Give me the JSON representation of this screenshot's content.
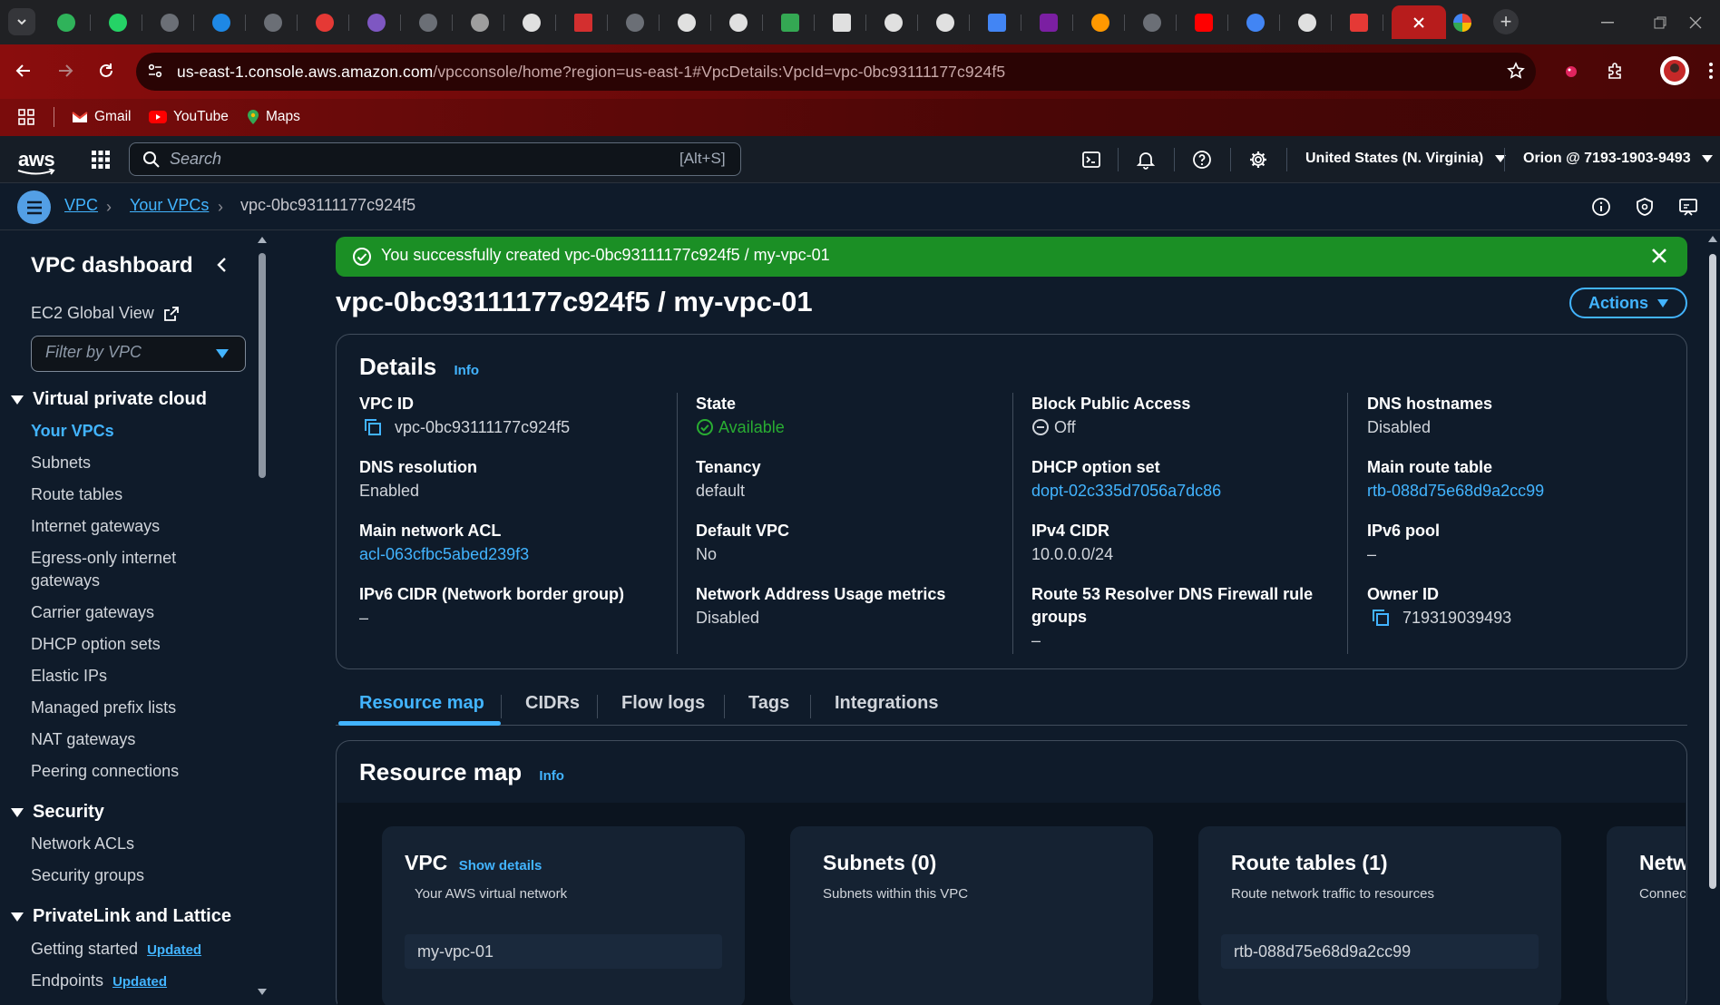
{
  "browser": {
    "url_domain": "us-east-1.console.aws.amazon.com",
    "url_path": "/vpcconsole/home?region=us-east-1#VpcDetails:VpcId=vpc-0bc93111177c924f5",
    "bookmarks": [
      {
        "label": "Gmail",
        "icon": "gmail-icon"
      },
      {
        "label": "YouTube",
        "icon": "youtube-icon"
      },
      {
        "label": "Maps",
        "icon": "maps-icon"
      }
    ]
  },
  "awsnav": {
    "logo": "aws",
    "search_placeholder": "Search",
    "search_shortcut": "[Alt+S]",
    "region": "United States (N. Virginia)",
    "account": "Orion @ 7193-1903-9493"
  },
  "breadcrumb": {
    "items": [
      "VPC",
      "Your VPCs"
    ],
    "current": "vpc-0bc93111177c924f5"
  },
  "sidebar": {
    "title": "VPC dashboard",
    "global_view": "EC2 Global View",
    "filter_placeholder": "Filter by VPC",
    "sections": [
      {
        "title": "Virtual private cloud",
        "items": [
          "Your VPCs",
          "Subnets",
          "Route tables",
          "Internet gateways",
          "Egress-only internet",
          "gateways",
          "Carrier gateways",
          "DHCP option sets",
          "Elastic IPs",
          "Managed prefix lists",
          "NAT gateways",
          "Peering connections"
        ]
      },
      {
        "title": "Security",
        "items": [
          "Network ACLs",
          "Security groups"
        ]
      },
      {
        "title": "PrivateLink and Lattice",
        "items": [
          "Getting started",
          "Endpoints"
        ]
      }
    ],
    "updated_badge": "Updated"
  },
  "flash": {
    "message": "You successfully created vpc-0bc93111177c924f5 / my-vpc-01",
    "color": "#1b8f25"
  },
  "page": {
    "title": "vpc-0bc93111177c924f5 / my-vpc-01",
    "actions_label": "Actions"
  },
  "details": {
    "title": "Details",
    "info": "Info",
    "columns": [
      [
        {
          "label": "VPC ID",
          "value": "vpc-0bc93111177c924f5"
        },
        {
          "label": "DNS resolution",
          "value": "Enabled"
        },
        {
          "label": "Main network ACL",
          "value": "acl-063cfbc5abed239f3"
        },
        {
          "label": "IPv6 CIDR (Network border group)",
          "value": "–"
        }
      ],
      [
        {
          "label": "State",
          "value": "Available"
        },
        {
          "label": "Tenancy",
          "value": "default"
        },
        {
          "label": "Default VPC",
          "value": "No"
        },
        {
          "label": "Network Address Usage metrics",
          "value": "Disabled"
        }
      ],
      [
        {
          "label": "Block Public Access",
          "value": "Off"
        },
        {
          "label": "DHCP option set",
          "value": "dopt-02c335d7056a7dc86"
        },
        {
          "label": "IPv4 CIDR",
          "value": "10.0.0.0/24"
        },
        {
          "label": "Route 53 Resolver DNS Firewall rule",
          "label2": "groups",
          "value": "–"
        }
      ],
      [
        {
          "label": "DNS hostnames",
          "value": "Disabled"
        },
        {
          "label": "Main route table",
          "value": "rtb-088d75e68d9a2cc99"
        },
        {
          "label": "IPv6 pool",
          "value": "–"
        },
        {
          "label": "Owner ID",
          "value": "719319039493"
        }
      ]
    ]
  },
  "tabs": [
    "Resource map",
    "CIDRs",
    "Flow logs",
    "Tags",
    "Integrations"
  ],
  "resource_map": {
    "title": "Resource map",
    "info": "Info",
    "cards": [
      {
        "title": "VPC",
        "link": "Show details",
        "subtitle": "Your AWS virtual network",
        "value": "my-vpc-01"
      },
      {
        "title": "Subnets (0)",
        "subtitle": "Subnets within this VPC"
      },
      {
        "title": "Route tables (1)",
        "subtitle": "Route network traffic to resources",
        "value": "rtb-088d75e68d9a2cc99"
      },
      {
        "title": "Netw",
        "subtitle": "Connec"
      }
    ]
  },
  "colors": {
    "link": "#42b4ff",
    "available": "#29ad32",
    "background": "#0f1b2a"
  }
}
